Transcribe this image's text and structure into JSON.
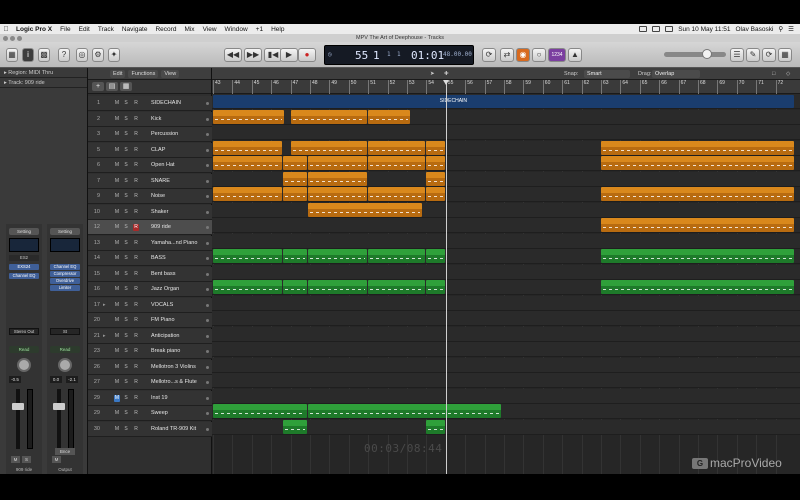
{
  "menubar": {
    "app": "Logic Pro X",
    "items": [
      "File",
      "Edit",
      "Track",
      "Navigate",
      "Record",
      "Mix",
      "View",
      "Window",
      "+1",
      "Help"
    ],
    "clock": "Sun 10 May  11:51",
    "user": "Olav Basoski"
  },
  "window": {
    "title": "MPV The Art of Deephouse - Tracks"
  },
  "lcd": {
    "bar": "55",
    "beat": "1",
    "div": "1",
    "tick": "1",
    "time": "01:01",
    "subtime": "48.00.00"
  },
  "toolbar": {
    "pill_label": "1234"
  },
  "inspector": {
    "region_label": "Region: MIDI Thru",
    "track_label": "Track: 909 ride",
    "strip1": {
      "setting": "Setting",
      "plugins": [
        "ES2",
        "EXS24",
        "Channel EQ"
      ],
      "io": "Stereo Out",
      "read": "Read",
      "val1": "-0.5",
      "val2": "",
      "name": "909 ride"
    },
    "strip2": {
      "setting": "Setting",
      "plugins": [
        "Channel EQ",
        "Compressor",
        "Overdrive",
        "Limiter"
      ],
      "io": "St",
      "read": "Read",
      "val1": "0.0",
      "val2": "-2.1",
      "name": "Output",
      "bnce": "Bnce"
    }
  },
  "trackheader": {
    "menus": [
      "Edit",
      "Functions",
      "View"
    ]
  },
  "arrange_toolbar": {
    "snap_label": "Snap:",
    "snap_value": "Smart",
    "drag_label": "Drag:",
    "drag_value": "Overlap"
  },
  "ruler": {
    "bars": [
      "43",
      "44",
      "45",
      "46",
      "47",
      "48",
      "49",
      "50",
      "51",
      "52",
      "53",
      "54",
      "55",
      "56",
      "57",
      "58",
      "59",
      "60",
      "61",
      "62",
      "63",
      "64",
      "65",
      "66",
      "67",
      "68",
      "69",
      "70",
      "71",
      "72"
    ]
  },
  "tracks": [
    {
      "num": "1",
      "name": "SIDECHAIN"
    },
    {
      "num": "2",
      "name": "Kick"
    },
    {
      "num": "3",
      "name": "Percussion"
    },
    {
      "num": "5",
      "name": "CLAP"
    },
    {
      "num": "6",
      "name": "Open Hat"
    },
    {
      "num": "7",
      "name": "SNARE"
    },
    {
      "num": "9",
      "name": "Noise"
    },
    {
      "num": "10",
      "name": "Shaker"
    },
    {
      "num": "12",
      "name": "909 ride"
    },
    {
      "num": "13",
      "name": "Yamaha...nd Piano"
    },
    {
      "num": "14",
      "name": "BASS"
    },
    {
      "num": "15",
      "name": "Bent bass"
    },
    {
      "num": "16",
      "name": "Jazz Organ"
    },
    {
      "num": "17",
      "name": "VOCALS"
    },
    {
      "num": "20",
      "name": "FM Piano"
    },
    {
      "num": "21",
      "name": "Anticipation"
    },
    {
      "num": "23",
      "name": "Break piano"
    },
    {
      "num": "26",
      "name": "Mellotron 3 Violins"
    },
    {
      "num": "27",
      "name": "Mellotro...s & Flute"
    },
    {
      "num": "29",
      "name": "Inst 19"
    },
    {
      "num": "29",
      "name": "Sweep"
    },
    {
      "num": "30",
      "name": "Roland TR-909 Kit"
    }
  ],
  "regions": [
    {
      "lane": 0,
      "start": 43,
      "end": 73,
      "color": "blue",
      "name": "SIDECHAIN"
    },
    {
      "lane": 1,
      "start": 43,
      "end": 46.7,
      "color": "orange",
      "name": "Kick"
    },
    {
      "lane": 1,
      "start": 47,
      "end": 51,
      "color": "orange",
      "name": "Kick"
    },
    {
      "lane": 1,
      "start": 51,
      "end": 53.2,
      "color": "orange",
      "name": ""
    },
    {
      "lane": 3,
      "start": 43,
      "end": 46.6,
      "color": "orange",
      "name": "CLAP"
    },
    {
      "lane": 3,
      "start": 47,
      "end": 51,
      "color": "orange",
      "name": "CLAP"
    },
    {
      "lane": 3,
      "start": 51,
      "end": 54,
      "color": "orange",
      "name": ""
    },
    {
      "lane": 3,
      "start": 54,
      "end": 55,
      "color": "orange",
      "name": "CLAP"
    },
    {
      "lane": 3,
      "start": 63,
      "end": 73,
      "color": "orange",
      "name": "CLAP"
    },
    {
      "lane": 4,
      "start": 43,
      "end": 46.6,
      "color": "orange",
      "name": "Open Hat"
    },
    {
      "lane": 4,
      "start": 46.6,
      "end": 47.9,
      "color": "orange",
      "name": "Open hi"
    },
    {
      "lane": 4,
      "start": 47.9,
      "end": 51,
      "color": "orange",
      "name": "Open Hat"
    },
    {
      "lane": 4,
      "start": 51,
      "end": 54,
      "color": "orange",
      "name": ""
    },
    {
      "lane": 4,
      "start": 54,
      "end": 55,
      "color": "orange",
      "name": "Open Hat"
    },
    {
      "lane": 4,
      "start": 63,
      "end": 73,
      "color": "orange",
      "name": "Open Hat"
    },
    {
      "lane": 5,
      "start": 46.6,
      "end": 47.9,
      "color": "orange",
      "name": "SNARE"
    },
    {
      "lane": 5,
      "start": 47.9,
      "end": 51,
      "color": "orange",
      "name": "SNARE"
    },
    {
      "lane": 5,
      "start": 54,
      "end": 55,
      "color": "orange",
      "name": "SNARE"
    },
    {
      "lane": 6,
      "start": 43,
      "end": 46.6,
      "color": "orange",
      "name": "Noise"
    },
    {
      "lane": 6,
      "start": 46.6,
      "end": 47.9,
      "color": "orange",
      "name": "Noise"
    },
    {
      "lane": 6,
      "start": 47.9,
      "end": 51,
      "color": "orange",
      "name": "Noise"
    },
    {
      "lane": 6,
      "start": 51,
      "end": 54,
      "color": "orange",
      "name": ""
    },
    {
      "lane": 6,
      "start": 54,
      "end": 55,
      "color": "orange",
      "name": "Noise"
    },
    {
      "lane": 6,
      "start": 63,
      "end": 73,
      "color": "orange",
      "name": "Noise"
    },
    {
      "lane": 7,
      "start": 47.9,
      "end": 53.8,
      "color": "orange",
      "name": "Shaker"
    },
    {
      "lane": 8,
      "start": 63,
      "end": 73,
      "color": "orange",
      "name": "909 ride"
    },
    {
      "lane": 10,
      "start": 43,
      "end": 46.6,
      "color": "green",
      "name": "BASS"
    },
    {
      "lane": 10,
      "start": 46.6,
      "end": 47.9,
      "color": "green",
      "name": "BASS"
    },
    {
      "lane": 10,
      "start": 47.9,
      "end": 51,
      "color": "green",
      "name": "BASS"
    },
    {
      "lane": 10,
      "start": 51,
      "end": 54,
      "color": "green",
      "name": ""
    },
    {
      "lane": 10,
      "start": 54,
      "end": 55,
      "color": "green",
      "name": "BASS"
    },
    {
      "lane": 10,
      "start": 63,
      "end": 73,
      "color": "green",
      "name": "BASS"
    },
    {
      "lane": 12,
      "start": 43,
      "end": 46.6,
      "color": "green",
      "name": "Jazz Organ"
    },
    {
      "lane": 12,
      "start": 46.6,
      "end": 47.9,
      "color": "green",
      "name": "Jazz Or"
    },
    {
      "lane": 12,
      "start": 47.9,
      "end": 51,
      "color": "green",
      "name": "Jazz Organ"
    },
    {
      "lane": 12,
      "start": 51,
      "end": 54,
      "color": "green",
      "name": ""
    },
    {
      "lane": 12,
      "start": 54,
      "end": 55,
      "color": "green",
      "name": "Jazz O"
    },
    {
      "lane": 12,
      "start": 63,
      "end": 73,
      "color": "green",
      "name": "Jazz Organ"
    },
    {
      "lane": 20,
      "start": 43,
      "end": 47.9,
      "color": "green",
      "name": "Sweep.3"
    },
    {
      "lane": 20,
      "start": 47.9,
      "end": 57.9,
      "color": "green",
      "name": "Sweep.4"
    },
    {
      "lane": 21,
      "start": 46.6,
      "end": 47.9,
      "color": "green",
      "name": "Roland"
    },
    {
      "lane": 21,
      "start": 54,
      "end": 55,
      "color": "green",
      "name": "Roland"
    }
  ],
  "playhead_bar": 55,
  "overlay": {
    "timecode": "00:03/08:44",
    "brand": "macProVideo",
    "brand_mark": "G"
  },
  "colors": {
    "orange": "#d9881c",
    "green": "#2fa03a",
    "blue": "#1a3d6e"
  }
}
